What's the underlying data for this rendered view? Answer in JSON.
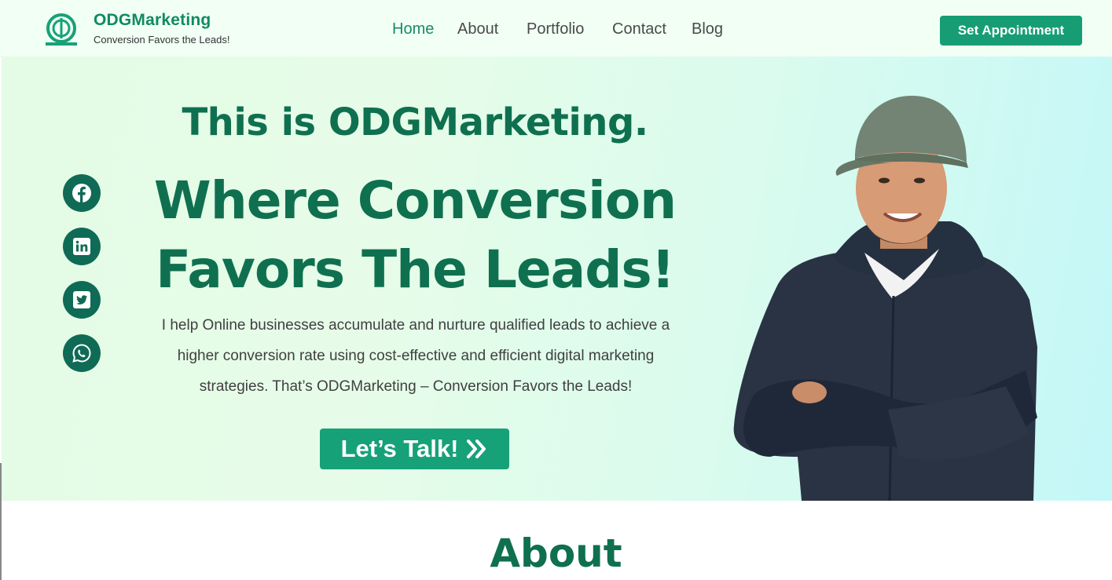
{
  "header": {
    "brand_name": "ODGMarketing",
    "brand_tagline": "Conversion Favors the Leads!",
    "nav": [
      {
        "label": "Home",
        "active": true
      },
      {
        "label": "About",
        "active": false
      },
      {
        "label": "Portfolio",
        "active": false
      },
      {
        "label": "Contact",
        "active": false
      },
      {
        "label": "Blog",
        "active": false
      }
    ],
    "cta_label": "Set Appointment"
  },
  "hero": {
    "title_small": "This is ODGMarketing.",
    "title_line1": "Where Conversion",
    "title_line2": "Favors The Leads!",
    "description": "I help Online businesses accumulate and nurture qualified leads to achieve a higher conversion rate using cost-effective and efficient digital marketing strategies. That’s ODGMarketing – Conversion Favors the Leads!",
    "button_label": "Let’s Talk!",
    "button_icon": "double-chevron-right-icon"
  },
  "social_icons": [
    "facebook-icon",
    "linkedin-icon",
    "twitter-icon",
    "whatsapp-icon"
  ],
  "section": {
    "about_title": "About"
  },
  "colors": {
    "brand_green": "#179d74",
    "heading_green": "#0f7050",
    "social_bg": "#0f6b55"
  }
}
